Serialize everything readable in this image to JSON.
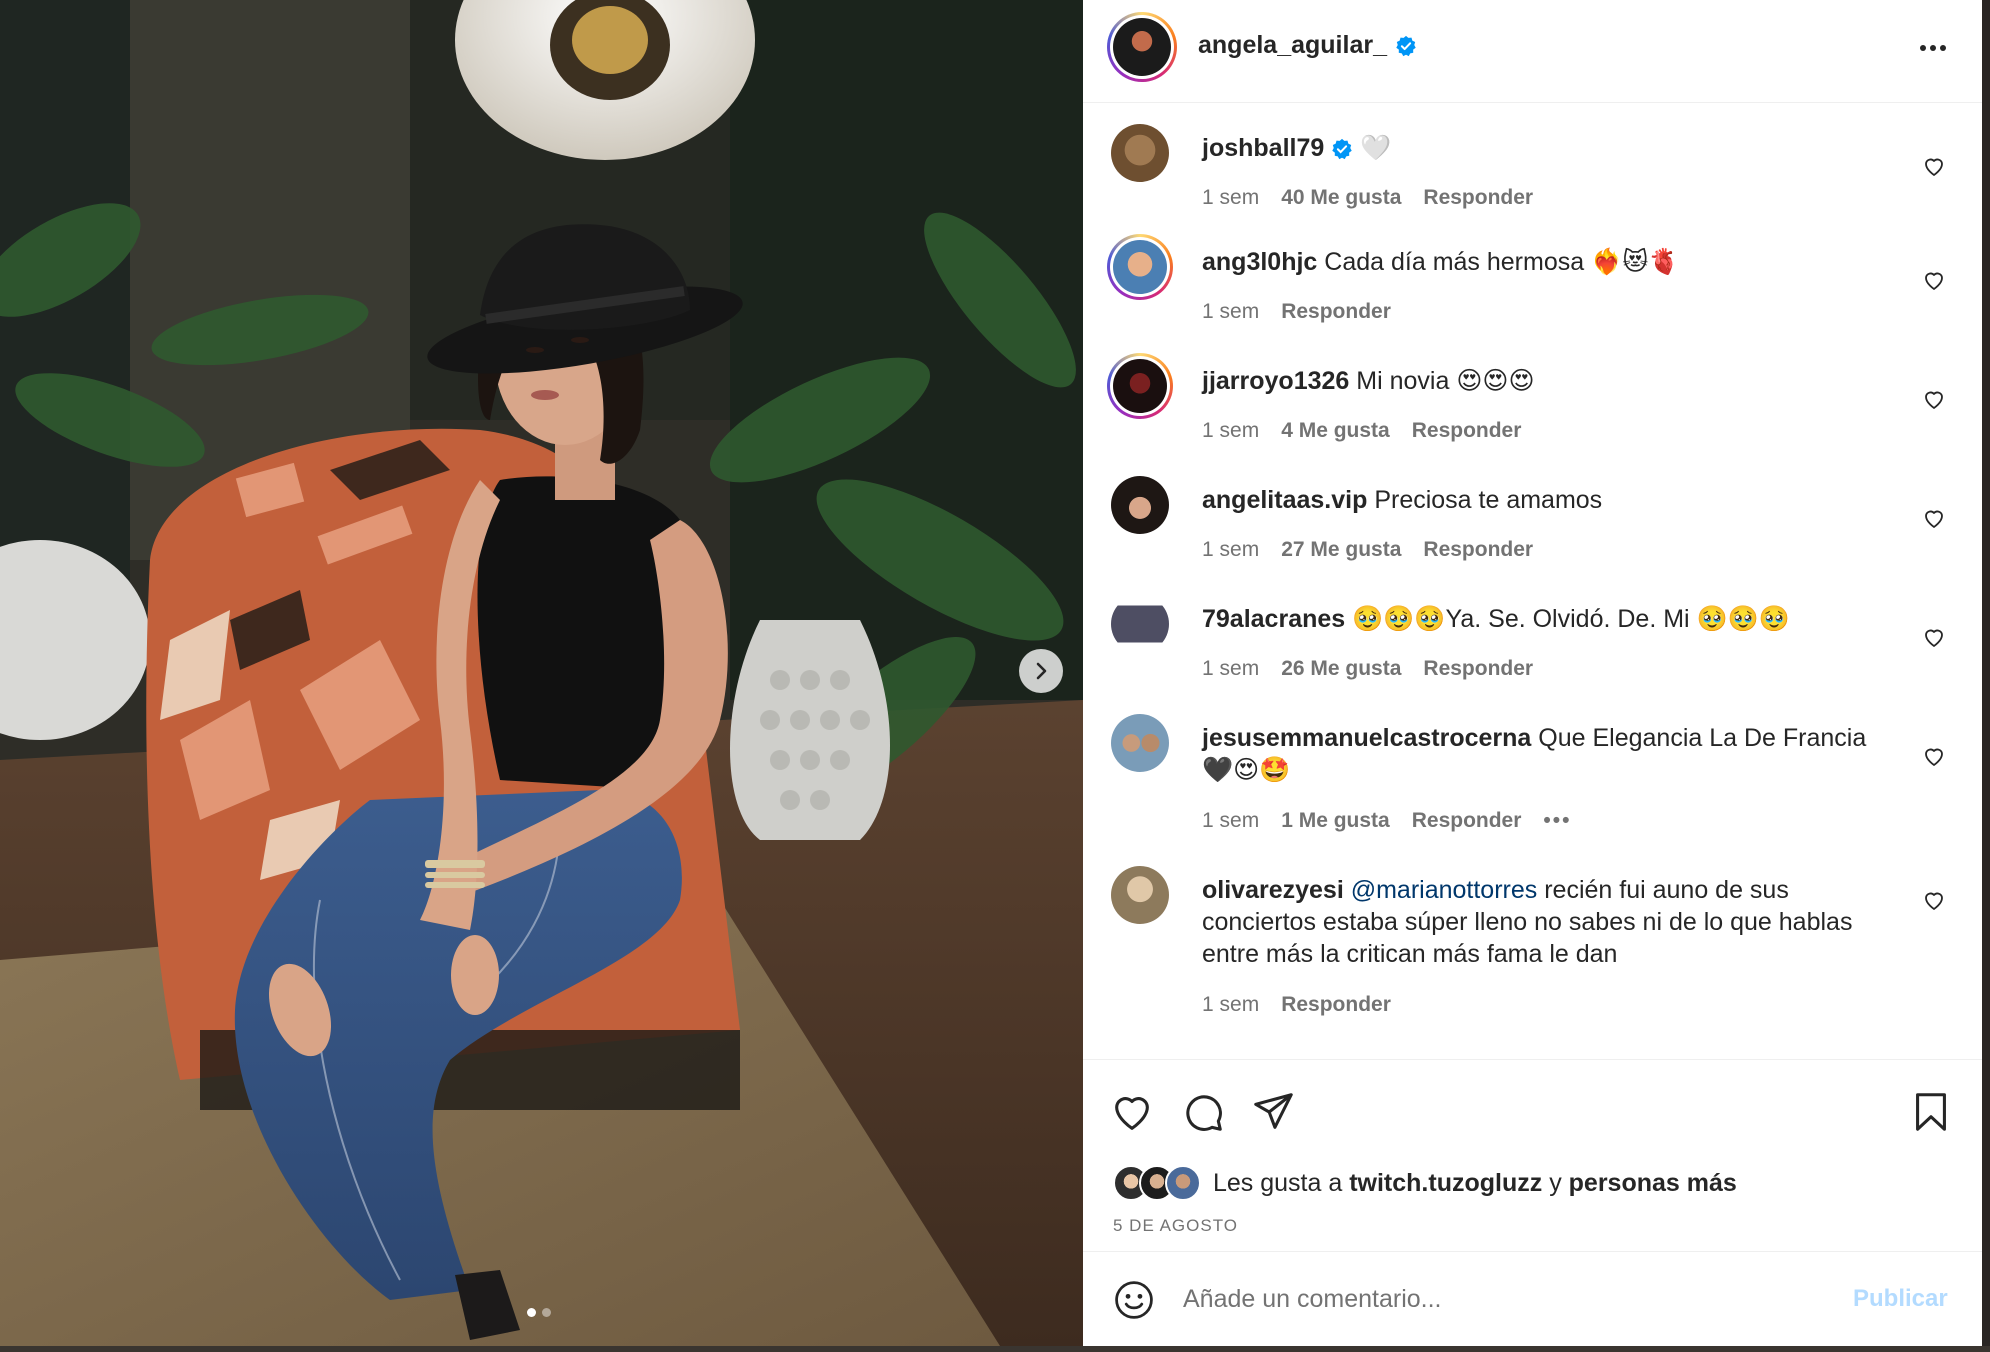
{
  "post": {
    "author": "angela_aguilar_",
    "verified": true,
    "date": "5 DE AGOSTO",
    "carousel": {
      "total_slides": 2,
      "current_slide": 1
    }
  },
  "comments": [
    {
      "user": "joshball79",
      "verified": true,
      "text": "🤍",
      "time": "1 sem",
      "likes": "40 Me gusta",
      "reply": "Responder",
      "ring": false,
      "avatar_color": "#7a5a3a"
    },
    {
      "user": "ang3l0hjc",
      "verified": false,
      "text": "Cada día más hermosa ❤️‍🔥😻🫀",
      "time": "1 sem",
      "likes": "",
      "reply": "Responder",
      "ring": true,
      "avatar_color": "#4b7fb3"
    },
    {
      "user": "jjarroyo1326",
      "verified": false,
      "text": "Mi novia 😍😍😍",
      "time": "1 sem",
      "likes": "4 Me gusta",
      "reply": "Responder",
      "ring": true,
      "avatar_color": "#3a1f1f"
    },
    {
      "user": "angelitaas.vip",
      "verified": false,
      "text": "Preciosa te amamos",
      "time": "1 sem",
      "likes": "27 Me gusta",
      "reply": "Responder",
      "ring": false,
      "avatar_color": "#2b2320"
    },
    {
      "user": "79alacranes",
      "verified": false,
      "text": "🥹🥹🥹Ya. Se. Olvidó. De. Mi 🥹🥹🥹",
      "time": "1 sem",
      "likes": "26 Me gusta",
      "reply": "Responder",
      "ring": false,
      "avatar_color": "#5a5a6a"
    },
    {
      "user": "jesusemmanuelcastrocerna",
      "verified": false,
      "text": "Que Elegancia La De Francia 🖤😍🤩",
      "time": "1 sem",
      "likes": "1 Me gusta",
      "reply": "Responder",
      "more": "•••",
      "ring": false,
      "avatar_color": "#6a8aa8"
    },
    {
      "user": "olivarezyesi",
      "verified": false,
      "mention": "@marianottorres",
      "text": "recién fui auno de sus conciertos estaba súper lleno no sabes ni de lo que hablas entre más la critican más fama le dan",
      "time": "1 sem",
      "likes": "",
      "reply": "Responder",
      "ring": false,
      "avatar_color": "#8a7a60"
    }
  ],
  "likes_summary": {
    "prefix": "Les gusta a",
    "user": "twitch.tuzogluzz",
    "conjunction": "y",
    "others": "personas más"
  },
  "composer": {
    "placeholder": "Añade un comentario...",
    "publish_label": "Publicar"
  },
  "icons": {
    "header_more": "more-horizontal-icon",
    "like": "heart-icon",
    "comment": "comment-icon",
    "share": "send-icon",
    "save": "bookmark-icon",
    "emoji": "emoji-icon",
    "next": "chevron-right-icon"
  },
  "colors": {
    "text": "#262626",
    "secondary": "#737373",
    "verified": "#0095f6",
    "mention": "#00376b",
    "publish_disabled": "#b3dbff"
  }
}
